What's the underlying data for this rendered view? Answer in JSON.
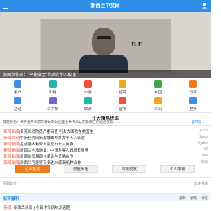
{
  "header": {
    "title": "新西兰中文网",
    "menu_icon": "menu-icon",
    "profile_icon": "user-icon",
    "bar_color": "#2e8fe6"
  },
  "banner": {
    "caption": "美国女作家：\"神秘赠金\"背后的华人故事",
    "signature": "D.F.",
    "slide_count": 5,
    "active_slide": 1
  },
  "grid": {
    "items": [
      {
        "label": "用户",
        "icon": "user-icon",
        "color": "#3b8ee8"
      },
      {
        "label": "出租",
        "icon": "house-icon",
        "color": "#26b3a8"
      },
      {
        "label": "市场",
        "icon": "cart-icon",
        "color": "#f0503a"
      },
      {
        "label": "招聘",
        "icon": "briefcase-icon",
        "color": "#f0a81e"
      },
      {
        "label": "美国",
        "icon": "globe-icon",
        "color": "#3fa44a"
      },
      {
        "label": "分享",
        "icon": "share-icon",
        "color": "#f07b1e"
      },
      {
        "label": "活动",
        "icon": "calendar-icon",
        "color": "#3b8ee8"
      },
      {
        "label": "二手车",
        "icon": "car-icon",
        "color": "#7b5fd6"
      },
      {
        "label": "旅游",
        "icon": "plane-icon",
        "color": "#26b3a8"
      },
      {
        "label": "留学",
        "icon": "graduation-icon",
        "color": "#f0503a"
      },
      {
        "label": "资讯",
        "icon": "news-icon",
        "color": "#f0a81e"
      },
      {
        "label": "更多",
        "icon": "more-icon",
        "color": "#3b8ee8"
      }
    ]
  },
  "hot": {
    "title": "十大精品优选",
    "summary": "技能特色：世界遗产和您的奇葩新公园里士世界公认的新西兰的原居发现……",
    "detail_link": "[详情]"
  },
  "news": [
    {
      "tag": "[新闻新闻]",
      "text": "奥克兰消防员严格审查 引发大面积在美国生",
      "source": "Auckl"
    },
    {
      "tag": "[新闻资讯]",
      "text": "中新社侨网新加坡联邦西方半入人事迹",
      "source": "Samo"
    },
    {
      "tag": "[新闻新闻]",
      "text": "盘点澳大利亚人最爱的十大美食",
      "source": "Sydne"
    },
    {
      "tag": "[新闻新闻]",
      "text": "新西兰人旅游业：中国游客人数增长显著",
      "source": "NZ"
    },
    {
      "tag": "[新闻新闻]",
      "text": "新西兰贸易部长承认与贸易合作",
      "source": "Wel"
    },
    {
      "tag": "[新闻新闻]",
      "text": "新西兰可能将有多达20家新机构合作",
      "source": "新闻"
    }
  ],
  "tabs": [
    {
      "label": "企业招聘",
      "active": true
    },
    {
      "label": "房屋出租",
      "active": false
    },
    {
      "label": "同城交友",
      "active": false
    },
    {
      "label": "个人求职",
      "active": false
    }
  ],
  "subrow": {
    "left": "招聘职位",
    "right": "工资待遇"
  },
  "section": {
    "name": "城市爆料",
    "links": [
      "最新",
      "最热",
      "评论"
    ]
  },
  "bottom": {
    "tag": "[新闻]",
    "text": "新西兰新闻 | 今日中文网热议话题"
  }
}
